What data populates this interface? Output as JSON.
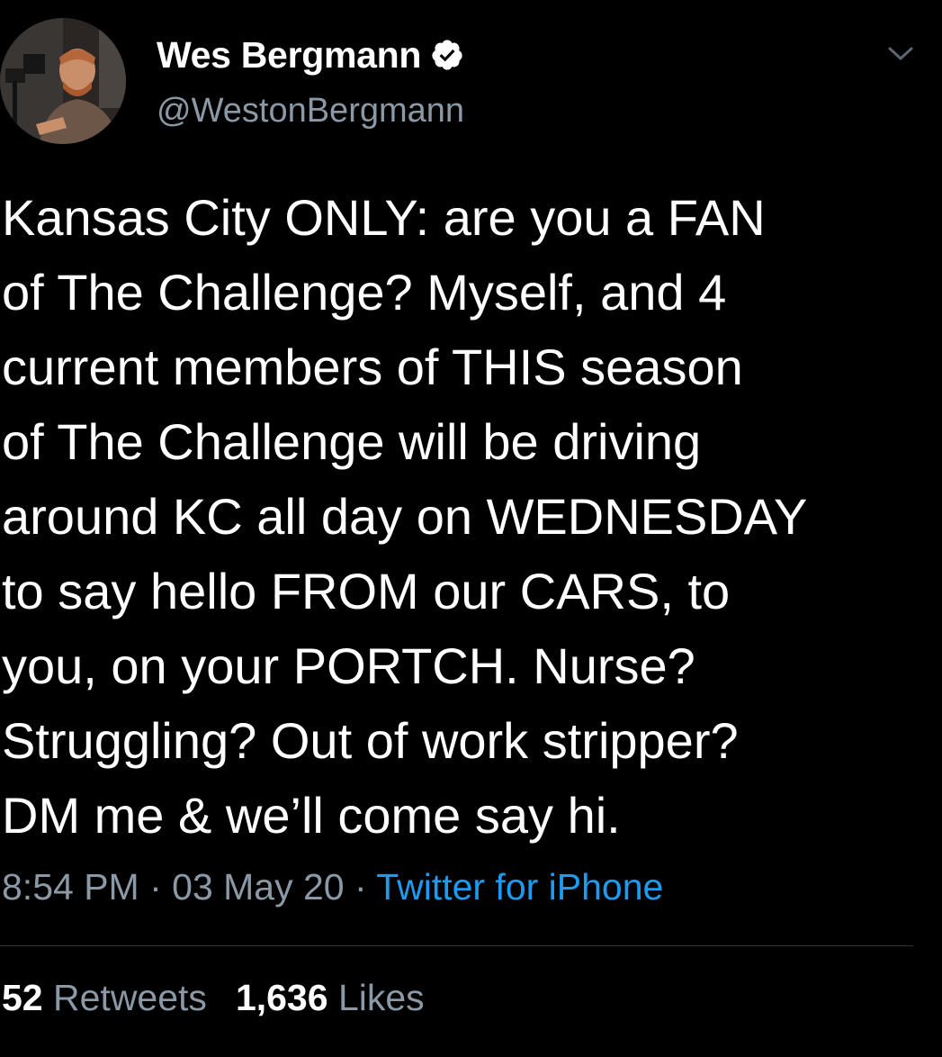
{
  "user": {
    "display_name": "Wes Bergmann",
    "handle": "@WestonBergmann",
    "verified": true,
    "avatar_icon": "profile-photo"
  },
  "tweet": {
    "text": "Kansas City ONLY: are you a FAN\nof The Challenge? Myself, and 4\ncurrent members of THIS season\nof The Challenge will be driving\naround KC all day on WEDNESDAY\nto say hello FROM our CARS, to\nyou, on your PORTCH. Nurse?\nStruggling? Out of work stripper?\nDM me & we’ll come say hi.",
    "time": "8:54 PM",
    "separator": " · ",
    "date": "03 May 20",
    "source": "Twitter for iPhone"
  },
  "stats": {
    "retweets_count": "52",
    "retweets_label": "Retweets",
    "likes_count": "1,636",
    "likes_label": "Likes"
  },
  "colors": {
    "background": "#000000",
    "text": "#ffffff",
    "secondary": "#8b98a5",
    "accent": "#1d9bf0",
    "divider": "#2f3336"
  },
  "icons": {
    "verified": "verified-badge-icon",
    "menu": "chevron-down-icon"
  }
}
